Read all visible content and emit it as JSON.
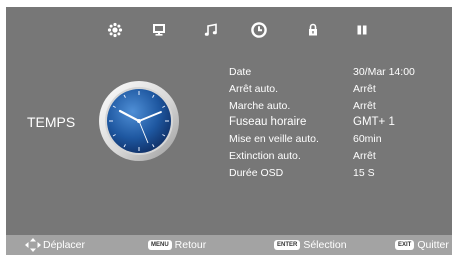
{
  "menu": {
    "items": [
      {
        "id": "image",
        "icon": "sun-icon",
        "active": false
      },
      {
        "id": "screen",
        "icon": "monitor-icon",
        "active": false
      },
      {
        "id": "sound",
        "icon": "music-note-icon",
        "active": false
      },
      {
        "id": "time",
        "icon": "clock-icon",
        "active": true
      },
      {
        "id": "lock",
        "icon": "lock-icon",
        "active": false
      },
      {
        "id": "setup",
        "icon": "pause-bars-icon",
        "active": false
      }
    ]
  },
  "section": {
    "title": "TEMPS"
  },
  "settings": [
    {
      "label": "Date",
      "value": "30/Mar  14:00"
    },
    {
      "label": "Arrêt auto.",
      "value": "Arrêt"
    },
    {
      "label": "Marche auto.",
      "value": "Arrêt"
    },
    {
      "label": "Fuseau horaire",
      "value": "GMT+ 1"
    },
    {
      "label": "Mise en veille auto.",
      "value": "60min"
    },
    {
      "label": "Extinction auto.",
      "value": "Arrêt"
    },
    {
      "label": "Durée OSD",
      "value": "15 S"
    }
  ],
  "footer": {
    "move": {
      "label": "Déplacer",
      "icon": "dpad-arrows-icon"
    },
    "back": {
      "key": "MENU",
      "label": "Retour"
    },
    "select": {
      "key": "ENTER",
      "label": "Sélection"
    },
    "quit": {
      "key": "EXIT",
      "label": "Quitter"
    }
  },
  "colors": {
    "background": "#777777",
    "footer": "#a3a3a3",
    "text": "#ffffff",
    "clock_face": "#1e57a0"
  }
}
